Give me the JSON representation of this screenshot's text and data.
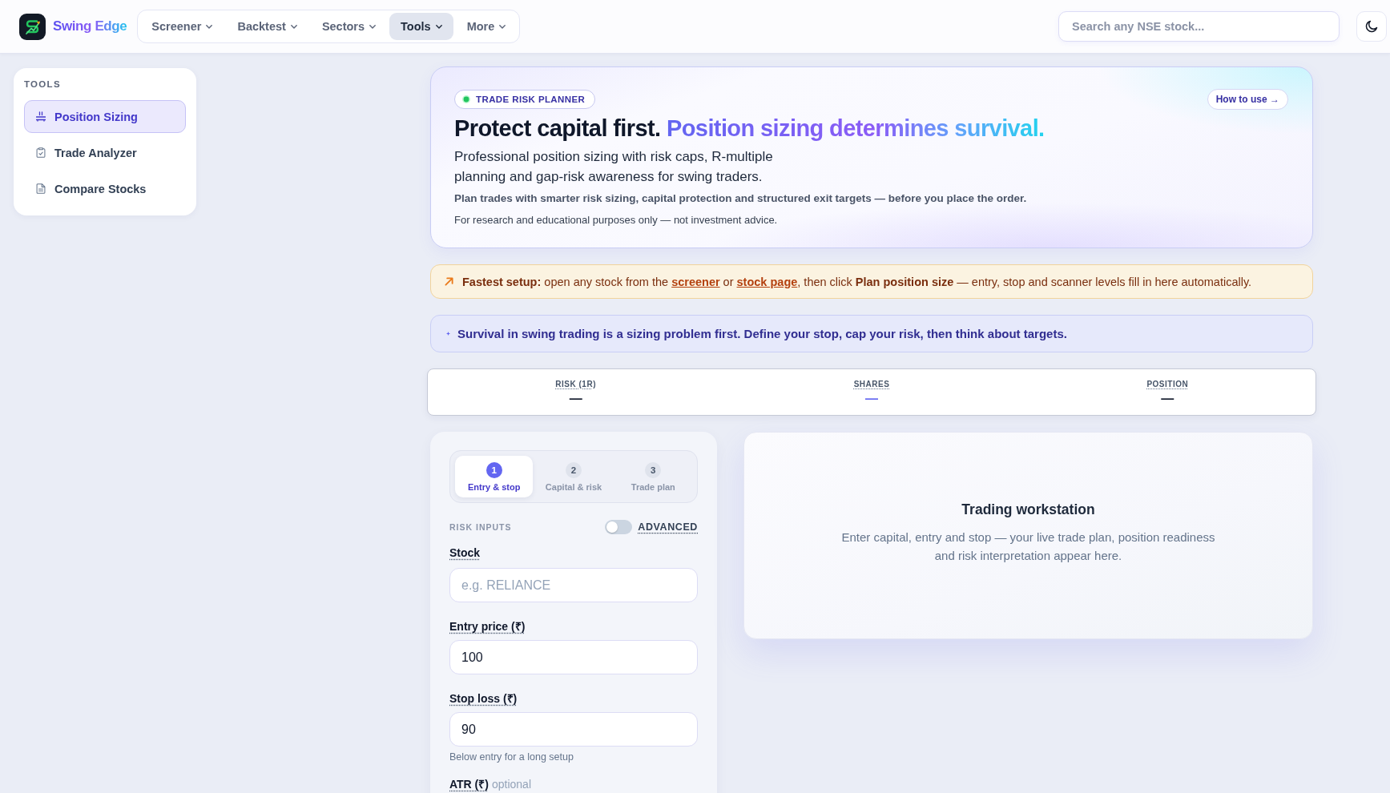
{
  "header": {
    "brand": "Swing Edge",
    "nav": [
      {
        "label": "Screener",
        "selected": false
      },
      {
        "label": "Backtest",
        "selected": false
      },
      {
        "label": "Sectors",
        "selected": false
      },
      {
        "label": "Tools",
        "selected": true
      },
      {
        "label": "More",
        "selected": false
      }
    ],
    "search": {
      "placeholder": "Search any NSE stock..."
    }
  },
  "sidebar": {
    "title": "TOOLS",
    "items": [
      {
        "label": "Position Sizing",
        "selected": true
      },
      {
        "label": "Trade Analyzer",
        "selected": false
      },
      {
        "label": "Compare Stocks",
        "selected": false
      }
    ]
  },
  "hero": {
    "badge": "TRADE RISK PLANNER",
    "help_button": "How to use →",
    "title_lead": "Protect capital first.",
    "title_highlight": "Position sizing determines survival.",
    "subtitle": "Professional position sizing with risk caps, R-multiple planning and gap-risk awareness for swing traders.",
    "tagline": "Plan trades with smarter risk sizing, capital protection and structured exit targets — before you place the order.",
    "disclaimer": "For research and educational purposes only — not investment advice."
  },
  "setup_tip": {
    "segments": [
      {
        "kind": "text",
        "text": "**Fastest setup:** open any stock from the "
      },
      {
        "kind": "link",
        "text": "screener"
      },
      {
        "kind": "text",
        "text": " or "
      },
      {
        "kind": "link",
        "text": "stock page"
      },
      {
        "kind": "text",
        "text": ", then click **Plan position size** — entry, stop and scanner levels fill in here automatically."
      }
    ]
  },
  "principle": "Survival in swing trading is a sizing problem first. Define your stop, cap your risk, then think about targets.",
  "stats": [
    {
      "label": "RISK (1R)",
      "value": "—",
      "color": "#0f172a"
    },
    {
      "label": "SHARES",
      "value": "—",
      "color": "#6366f1"
    },
    {
      "label": "POSITION",
      "value": "—",
      "color": "#0f172a"
    }
  ],
  "planner": {
    "steps": [
      {
        "number": "1",
        "label": "Entry & stop",
        "selected": true
      },
      {
        "number": "2",
        "label": "Capital & risk",
        "selected": false
      },
      {
        "number": "3",
        "label": "Trade plan",
        "selected": false
      }
    ],
    "section_title": "RISK INPUTS",
    "advanced_toggle": {
      "label": "ADVANCED",
      "on": false
    },
    "fields": [
      {
        "label": "Stock",
        "placeholder": "e.g. RELIANCE"
      },
      {
        "label": "Entry price (₹)",
        "value": "100"
      },
      {
        "label": "Stop loss (₹)",
        "value": "90",
        "hint": "Below entry for a long setup"
      },
      {
        "label": "ATR (₹)",
        "note": "optional"
      }
    ]
  },
  "workstation": {
    "title": "Trading workstation",
    "description": "Enter capital, entry and stop — your live trade plan, position readiness and risk interpretation appear here."
  }
}
